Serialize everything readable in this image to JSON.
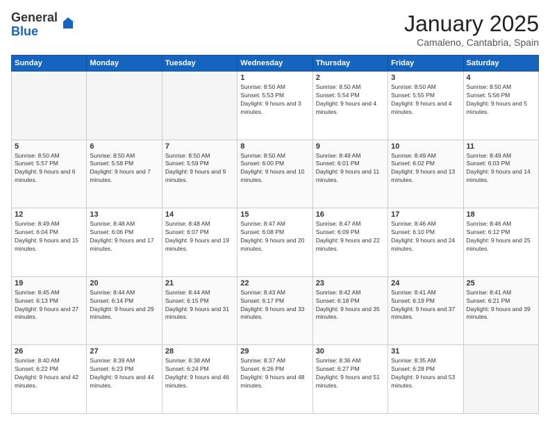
{
  "logo": {
    "general": "General",
    "blue": "Blue"
  },
  "header": {
    "month": "January 2025",
    "location": "Camaleno, Cantabria, Spain"
  },
  "weekdays": [
    "Sunday",
    "Monday",
    "Tuesday",
    "Wednesday",
    "Thursday",
    "Friday",
    "Saturday"
  ],
  "weeks": [
    [
      {
        "day": "",
        "info": ""
      },
      {
        "day": "",
        "info": ""
      },
      {
        "day": "",
        "info": ""
      },
      {
        "day": "1",
        "info": "Sunrise: 8:50 AM\nSunset: 5:53 PM\nDaylight: 9 hours and 3 minutes."
      },
      {
        "day": "2",
        "info": "Sunrise: 8:50 AM\nSunset: 5:54 PM\nDaylight: 9 hours and 4 minutes."
      },
      {
        "day": "3",
        "info": "Sunrise: 8:50 AM\nSunset: 5:55 PM\nDaylight: 9 hours and 4 minutes."
      },
      {
        "day": "4",
        "info": "Sunrise: 8:50 AM\nSunset: 5:56 PM\nDaylight: 9 hours and 5 minutes."
      }
    ],
    [
      {
        "day": "5",
        "info": "Sunrise: 8:50 AM\nSunset: 5:57 PM\nDaylight: 9 hours and 6 minutes."
      },
      {
        "day": "6",
        "info": "Sunrise: 8:50 AM\nSunset: 5:58 PM\nDaylight: 9 hours and 7 minutes."
      },
      {
        "day": "7",
        "info": "Sunrise: 8:50 AM\nSunset: 5:59 PM\nDaylight: 9 hours and 9 minutes."
      },
      {
        "day": "8",
        "info": "Sunrise: 8:50 AM\nSunset: 6:00 PM\nDaylight: 9 hours and 10 minutes."
      },
      {
        "day": "9",
        "info": "Sunrise: 8:49 AM\nSunset: 6:01 PM\nDaylight: 9 hours and 11 minutes."
      },
      {
        "day": "10",
        "info": "Sunrise: 8:49 AM\nSunset: 6:02 PM\nDaylight: 9 hours and 13 minutes."
      },
      {
        "day": "11",
        "info": "Sunrise: 8:49 AM\nSunset: 6:03 PM\nDaylight: 9 hours and 14 minutes."
      }
    ],
    [
      {
        "day": "12",
        "info": "Sunrise: 8:49 AM\nSunset: 6:04 PM\nDaylight: 9 hours and 15 minutes."
      },
      {
        "day": "13",
        "info": "Sunrise: 8:48 AM\nSunset: 6:06 PM\nDaylight: 9 hours and 17 minutes."
      },
      {
        "day": "14",
        "info": "Sunrise: 8:48 AM\nSunset: 6:07 PM\nDaylight: 9 hours and 19 minutes."
      },
      {
        "day": "15",
        "info": "Sunrise: 8:47 AM\nSunset: 6:08 PM\nDaylight: 9 hours and 20 minutes."
      },
      {
        "day": "16",
        "info": "Sunrise: 8:47 AM\nSunset: 6:09 PM\nDaylight: 9 hours and 22 minutes."
      },
      {
        "day": "17",
        "info": "Sunrise: 8:46 AM\nSunset: 6:10 PM\nDaylight: 9 hours and 24 minutes."
      },
      {
        "day": "18",
        "info": "Sunrise: 8:46 AM\nSunset: 6:12 PM\nDaylight: 9 hours and 25 minutes."
      }
    ],
    [
      {
        "day": "19",
        "info": "Sunrise: 8:45 AM\nSunset: 6:13 PM\nDaylight: 9 hours and 27 minutes."
      },
      {
        "day": "20",
        "info": "Sunrise: 8:44 AM\nSunset: 6:14 PM\nDaylight: 9 hours and 29 minutes."
      },
      {
        "day": "21",
        "info": "Sunrise: 8:44 AM\nSunset: 6:15 PM\nDaylight: 9 hours and 31 minutes."
      },
      {
        "day": "22",
        "info": "Sunrise: 8:43 AM\nSunset: 6:17 PM\nDaylight: 9 hours and 33 minutes."
      },
      {
        "day": "23",
        "info": "Sunrise: 8:42 AM\nSunset: 6:18 PM\nDaylight: 9 hours and 35 minutes."
      },
      {
        "day": "24",
        "info": "Sunrise: 8:41 AM\nSunset: 6:19 PM\nDaylight: 9 hours and 37 minutes."
      },
      {
        "day": "25",
        "info": "Sunrise: 8:41 AM\nSunset: 6:21 PM\nDaylight: 9 hours and 39 minutes."
      }
    ],
    [
      {
        "day": "26",
        "info": "Sunrise: 8:40 AM\nSunset: 6:22 PM\nDaylight: 9 hours and 42 minutes."
      },
      {
        "day": "27",
        "info": "Sunrise: 8:39 AM\nSunset: 6:23 PM\nDaylight: 9 hours and 44 minutes."
      },
      {
        "day": "28",
        "info": "Sunrise: 8:38 AM\nSunset: 6:24 PM\nDaylight: 9 hours and 46 minutes."
      },
      {
        "day": "29",
        "info": "Sunrise: 8:37 AM\nSunset: 6:26 PM\nDaylight: 9 hours and 48 minutes."
      },
      {
        "day": "30",
        "info": "Sunrise: 8:36 AM\nSunset: 6:27 PM\nDaylight: 9 hours and 51 minutes."
      },
      {
        "day": "31",
        "info": "Sunrise: 8:35 AM\nSunset: 6:28 PM\nDaylight: 9 hours and 53 minutes."
      },
      {
        "day": "",
        "info": ""
      }
    ]
  ]
}
